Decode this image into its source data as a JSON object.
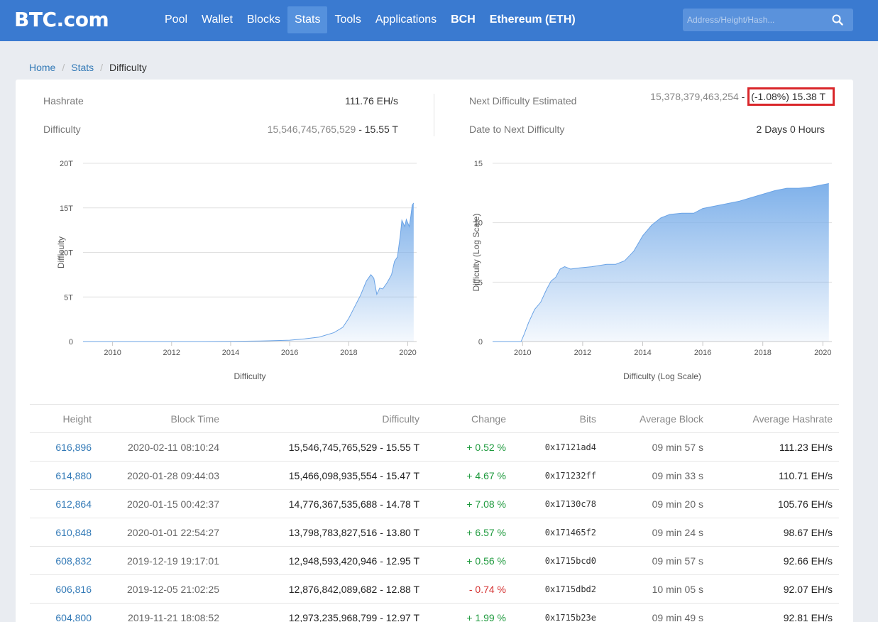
{
  "nav": {
    "logo": "BTC.com",
    "items": [
      {
        "label": "Pool"
      },
      {
        "label": "Wallet"
      },
      {
        "label": "Blocks"
      },
      {
        "label": "Stats"
      },
      {
        "label": "Tools"
      },
      {
        "label": "Applications"
      },
      {
        "label": "BCH"
      },
      {
        "label": "Ethereum (ETH)"
      }
    ],
    "active_item": "Stats",
    "search_placeholder": "Address/Height/Hash..."
  },
  "breadcrumb": {
    "home": "Home",
    "stats": "Stats",
    "current": "Difficulty"
  },
  "stats": {
    "hashrate_label": "Hashrate",
    "hashrate_value": "111.76 EH/s",
    "difficulty_label": "Difficulty",
    "difficulty_raw": "15,546,745,765,529",
    "difficulty_short": "15.55 T",
    "next_label": "Next Difficulty Estimated",
    "next_raw": "15,378,379,463,254",
    "next_change": "(-1.08%) 15.38 T",
    "date_label": "Date to Next Difficulty",
    "date_value": "2 Days 0 Hours"
  },
  "chart_data": [
    {
      "type": "area",
      "xlabel": "Difficulty",
      "ylabel": "Difficulty",
      "x_ticks": [
        "2010",
        "2012",
        "2014",
        "2016",
        "2018",
        "2020"
      ],
      "y_ticks": [
        "0",
        "5T",
        "10T",
        "15T",
        "20T"
      ],
      "ylim": [
        0,
        20
      ],
      "xlim": [
        2009.0,
        2020.3
      ],
      "grid": true,
      "x": [
        2009.0,
        2013.0,
        2014.0,
        2015.0,
        2016.0,
        2016.5,
        2017.0,
        2017.5,
        2017.8,
        2018.0,
        2018.2,
        2018.4,
        2018.6,
        2018.75,
        2018.85,
        2018.95,
        2019.05,
        2019.15,
        2019.3,
        2019.45,
        2019.55,
        2019.65,
        2019.75,
        2019.8,
        2019.9,
        2019.95,
        2020.05,
        2020.1,
        2020.15,
        2020.2
      ],
      "y": [
        0.0,
        0.0,
        0.02,
        0.06,
        0.15,
        0.3,
        0.5,
        1.0,
        1.6,
        2.6,
        3.9,
        5.2,
        6.8,
        7.5,
        7.1,
        5.3,
        6.0,
        5.9,
        6.6,
        7.5,
        9.0,
        9.5,
        12.0,
        13.6,
        12.9,
        13.7,
        12.9,
        14.0,
        15.3,
        15.55
      ]
    },
    {
      "type": "area",
      "xlabel": "Difficulty (Log Scale)",
      "ylabel": "Difficulty (Log Scale)",
      "x_ticks": [
        "2010",
        "2012",
        "2014",
        "2016",
        "2018",
        "2020"
      ],
      "y_ticks": [
        "0",
        "5",
        "10",
        "15"
      ],
      "ylim": [
        0,
        15
      ],
      "xlim": [
        2009.0,
        2020.3
      ],
      "grid": true,
      "x": [
        2009.0,
        2009.95,
        2010.05,
        2010.2,
        2010.4,
        2010.6,
        2010.8,
        2010.95,
        2011.1,
        2011.25,
        2011.4,
        2011.6,
        2011.9,
        2012.3,
        2012.8,
        2013.1,
        2013.4,
        2013.7,
        2014.0,
        2014.3,
        2014.6,
        2014.9,
        2015.3,
        2015.7,
        2016.0,
        2016.4,
        2016.8,
        2017.2,
        2017.6,
        2018.0,
        2018.4,
        2018.8,
        2019.0,
        2019.2,
        2019.6,
        2020.0,
        2020.2
      ],
      "y": [
        0.0,
        0.0,
        0.6,
        1.6,
        2.7,
        3.3,
        4.4,
        5.1,
        5.4,
        6.1,
        6.3,
        6.1,
        6.2,
        6.3,
        6.5,
        6.5,
        6.8,
        7.6,
        8.9,
        9.8,
        10.4,
        10.7,
        10.8,
        10.8,
        11.2,
        11.4,
        11.6,
        11.8,
        12.1,
        12.4,
        12.7,
        12.9,
        12.9,
        12.9,
        13.0,
        13.2,
        13.3
      ]
    }
  ],
  "table": {
    "headers": [
      "Height",
      "Block Time",
      "Difficulty",
      "Change",
      "Bits",
      "Average Block",
      "Average Hashrate"
    ],
    "rows": [
      {
        "height": "616,896",
        "time": "2020-02-11 08:10:24",
        "difficulty": "15,546,745,765,529 - 15.55 T",
        "change": "+ 0.52 %",
        "direction": "up",
        "bits": "0x17121ad4",
        "avg_block": "09 min 57 s",
        "avg_hashrate": "111.23 EH/s"
      },
      {
        "height": "614,880",
        "time": "2020-01-28 09:44:03",
        "difficulty": "15,466,098,935,554 - 15.47 T",
        "change": "+ 4.67 %",
        "direction": "up",
        "bits": "0x171232ff",
        "avg_block": "09 min 33 s",
        "avg_hashrate": "110.71 EH/s"
      },
      {
        "height": "612,864",
        "time": "2020-01-15 00:42:37",
        "difficulty": "14,776,367,535,688 - 14.78 T",
        "change": "+ 7.08 %",
        "direction": "up",
        "bits": "0x17130c78",
        "avg_block": "09 min 20 s",
        "avg_hashrate": "105.76 EH/s"
      },
      {
        "height": "610,848",
        "time": "2020-01-01 22:54:27",
        "difficulty": "13,798,783,827,516 - 13.80 T",
        "change": "+ 6.57 %",
        "direction": "up",
        "bits": "0x171465f2",
        "avg_block": "09 min 24 s",
        "avg_hashrate": "98.67 EH/s"
      },
      {
        "height": "608,832",
        "time": "2019-12-19 19:17:01",
        "difficulty": "12,948,593,420,946 - 12.95 T",
        "change": "+ 0.56 %",
        "direction": "up",
        "bits": "0x1715bcd0",
        "avg_block": "09 min 57 s",
        "avg_hashrate": "92.66 EH/s"
      },
      {
        "height": "606,816",
        "time": "2019-12-05 21:02:25",
        "difficulty": "12,876,842,089,682 - 12.88 T",
        "change": "- 0.74 %",
        "direction": "down",
        "bits": "0x1715dbd2",
        "avg_block": "10 min 05 s",
        "avg_hashrate": "92.07 EH/s"
      },
      {
        "height": "604,800",
        "time": "2019-11-21 18:08:52",
        "difficulty": "12,973,235,968,799 - 12.97 T",
        "change": "+ 1.99 %",
        "direction": "up",
        "bits": "0x1715b23e",
        "avg_block": "09 min 49 s",
        "avg_hashrate": "92.81 EH/s"
      }
    ]
  },
  "colors": {
    "nav_bg": "#3a7ad0",
    "area_fill": "#7fb1ea",
    "link": "#337ab7",
    "up": "#1e9a3d",
    "down": "#d43030",
    "highlight_border": "#d9262a"
  }
}
